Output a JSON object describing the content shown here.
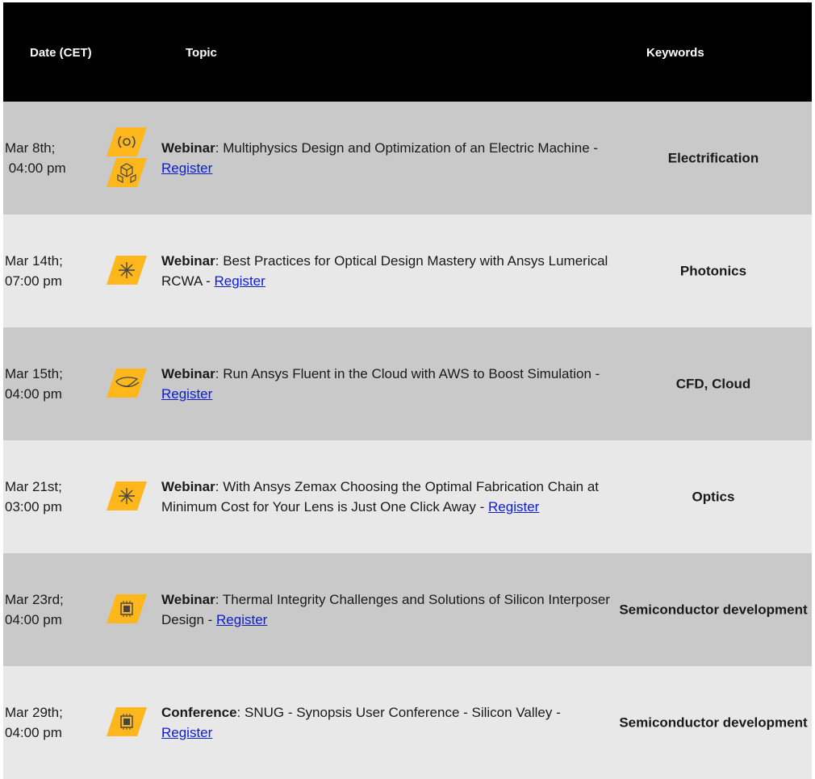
{
  "header": {
    "date": "Date (CET)",
    "topic": "Topic",
    "keywords": "Keywords"
  },
  "rows": [
    {
      "date_line1": "Mar 8th;",
      "date_line2": " 04:00 pm",
      "type": "Webinar",
      "text": ": Multiphysics Design and Optimization of an Electric Machine - ",
      "link": "Register",
      "keywords": "Electrification",
      "icons": [
        "electromagnetic-icon",
        "structures-icon"
      ]
    },
    {
      "date_line1": "Mar 14th;",
      "date_line2": "07:00 pm",
      "type": "Webinar",
      "text": ": Best Practices for Optical Design Mastery with Ansys Lumerical RCWA - ",
      "link": "Register",
      "keywords": "Photonics",
      "icons": [
        "optics-icon"
      ]
    },
    {
      "date_line1": "Mar 15th;",
      "date_line2": "04:00 pm",
      "type": "Webinar",
      "text": ": Run Ansys Fluent in the Cloud with AWS to Boost Simulation - ",
      "link": "Register",
      "keywords": "CFD, Cloud",
      "icons": [
        "fluids-icon"
      ]
    },
    {
      "date_line1": "Mar 21st;",
      "date_line2": "03:00 pm",
      "type": "Webinar",
      "text": ": With Ansys Zemax Choosing the Optimal Fabrication Chain at Minimum Cost for Your Lens is Just One Click Away - ",
      "link": "Register",
      "keywords": "Optics",
      "icons": [
        "optics-icon"
      ]
    },
    {
      "date_line1": "Mar 23rd;",
      "date_line2": "04:00 pm",
      "type": "Webinar",
      "text": ": Thermal Integrity Challenges and Solutions of Silicon Interposer Design - ",
      "link": "Register",
      "keywords": "Semiconductor development",
      "icons": [
        "chip-icon"
      ]
    },
    {
      "date_line1": "Mar 29th;",
      "date_line2": "04:00 pm",
      "type": "Conference",
      "text": ": SNUG - Synopsis User Conference - Silicon Valley - ",
      "link": "Register",
      "keywords": "Semiconductor development",
      "icons": [
        "chip-icon"
      ]
    }
  ],
  "colors": {
    "header_bg": "#000000",
    "row_dark": "#c9c9c9",
    "row_light": "#e8e8e8",
    "icon_accent": "#ffb71b",
    "link": "#0b1bd6"
  }
}
